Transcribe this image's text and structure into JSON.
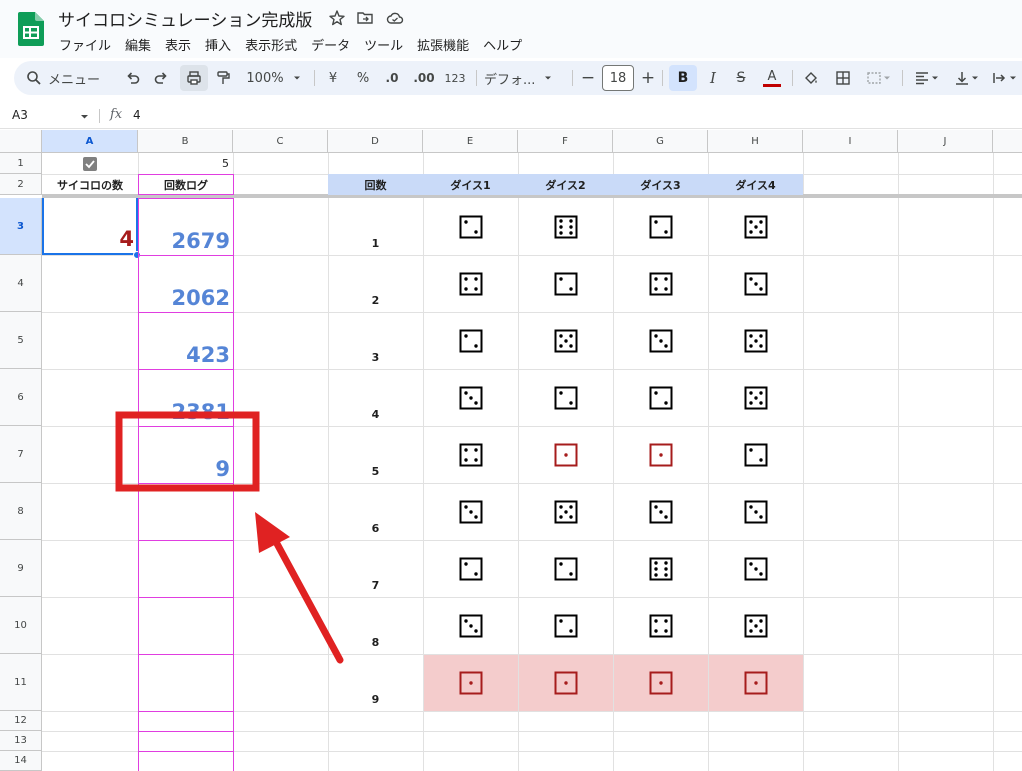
{
  "doc": {
    "title": "サイコロシミュレーション完成版"
  },
  "menu": [
    "ファイル",
    "編集",
    "表示",
    "挿入",
    "表示形式",
    "データ",
    "ツール",
    "拡張機能",
    "ヘルプ"
  ],
  "toolbar": {
    "search_label": "メニュー",
    "zoom": "100%",
    "currency": "¥",
    "percent": "%",
    "decrease_decimal": ".0",
    "increase_decimal": ".00",
    "number_format": "123",
    "font": "デフォ...",
    "font_size": "18",
    "text_color": "#c00000"
  },
  "formula": {
    "cell_ref": "A3",
    "value": "4"
  },
  "columns": [
    "A",
    "B",
    "C",
    "D",
    "E",
    "F",
    "G",
    "H",
    "I",
    "J"
  ],
  "rows": [
    "1",
    "2",
    "3",
    "4",
    "5",
    "6",
    "7",
    "8",
    "9",
    "10",
    "11",
    "12",
    "13",
    "14"
  ],
  "sheet": {
    "b1": "5",
    "a2": "サイコロの数",
    "b2": "回数ログ",
    "a3": "4",
    "log": [
      "2679",
      "2062",
      "423",
      "2381",
      "9"
    ],
    "table_headers": [
      "回数",
      "ダイス1",
      "ダイス2",
      "ダイス3",
      "ダイス4"
    ],
    "roll_numbers": [
      "1",
      "2",
      "3",
      "4",
      "5",
      "6",
      "7",
      "8",
      "9"
    ],
    "dice": [
      [
        2,
        6,
        2,
        5
      ],
      [
        4,
        2,
        4,
        3
      ],
      [
        2,
        5,
        3,
        5
      ],
      [
        3,
        2,
        2,
        5
      ],
      [
        4,
        1,
        1,
        2
      ],
      [
        3,
        5,
        3,
        3
      ],
      [
        2,
        2,
        6,
        3
      ],
      [
        3,
        2,
        4,
        5
      ],
      [
        1,
        1,
        1,
        1
      ]
    ],
    "checkbox_checked": true
  },
  "colors": {
    "accent_blue": "#5585d6",
    "value_red": "#a61c1c",
    "header_fill": "#c9daf8",
    "highlight_fill": "#f4cccc",
    "annotation_red": "#e02222",
    "border_magenta": "#e03ee0"
  }
}
